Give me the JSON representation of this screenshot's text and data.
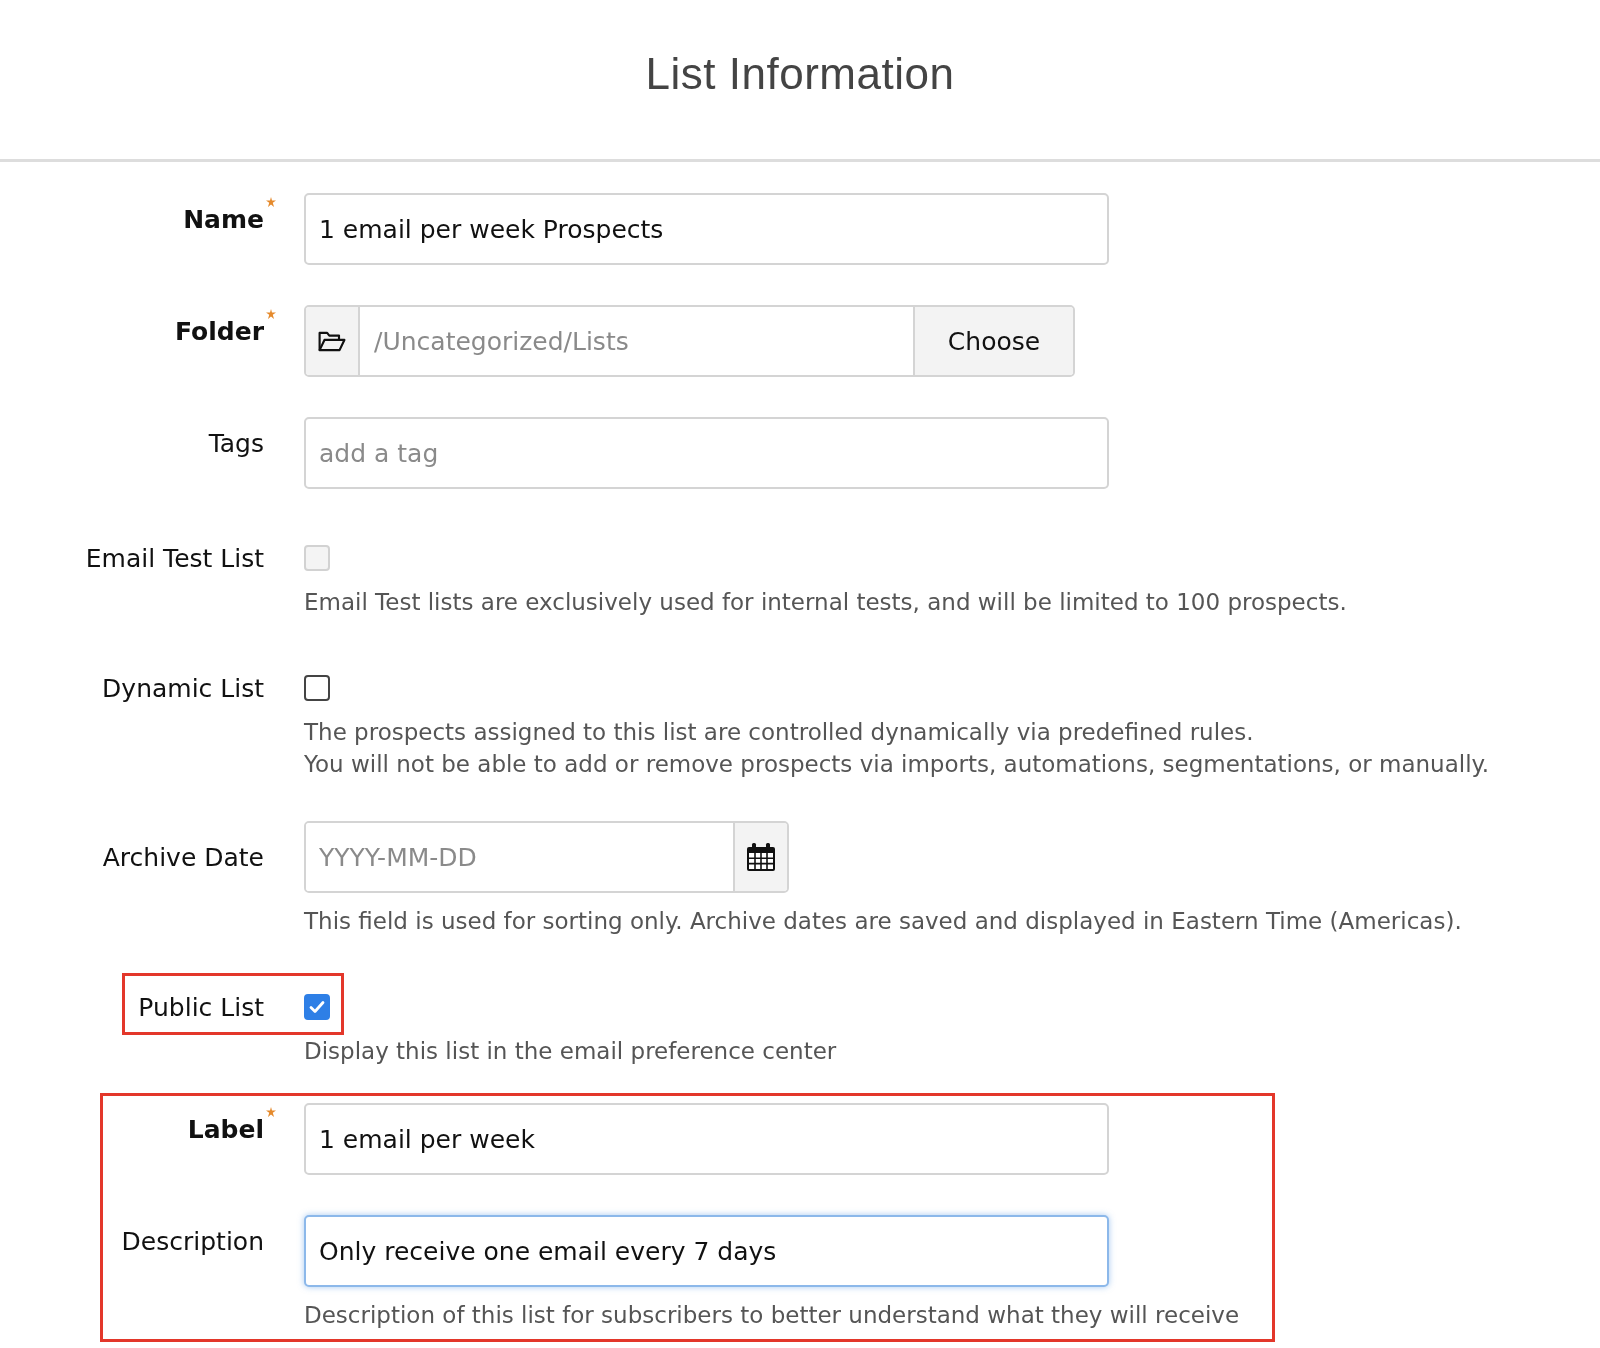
{
  "title": "List Information",
  "fields": [
    {
      "kind": "text",
      "label": "Name",
      "required": true,
      "value": "1 email per week Prospects"
    },
    {
      "kind": "folder",
      "label": "Folder",
      "required": true,
      "placeholder": "/Uncategorized/Lists",
      "button": "Choose"
    },
    {
      "kind": "text",
      "label": "Tags",
      "required": false,
      "placeholder": "add a tag"
    },
    {
      "kind": "checkbox",
      "label": "Email Test List",
      "required": false,
      "checked": false,
      "disabled": true,
      "highlighted": false,
      "help": [
        "Email Test lists are exclusively used for internal tests, and will be limited to 100 prospects."
      ]
    },
    {
      "kind": "checkbox",
      "label": "Dynamic List",
      "required": false,
      "checked": false,
      "disabled": false,
      "highlighted": false,
      "help": [
        "The prospects assigned to this list are controlled dynamically via predefined rules.",
        "You will not be able to add or remove prospects via imports, automations, segmentations, or manually."
      ]
    },
    {
      "kind": "date",
      "label": "Archive Date",
      "required": false,
      "placeholder": "YYYY-MM-DD",
      "help": [
        "This field is used for sorting only. Archive dates are saved and displayed in Eastern Time (Americas)."
      ]
    },
    {
      "kind": "checkbox",
      "label": "Public List",
      "required": false,
      "checked": true,
      "disabled": false,
      "highlighted": true,
      "help": [
        "Display this list in the email preference center"
      ]
    }
  ],
  "preference_group": {
    "highlighted": true,
    "fields": [
      {
        "kind": "text",
        "label": "Label",
        "required": true,
        "value": "1 email per week",
        "focused": false
      },
      {
        "kind": "text",
        "label": "Description",
        "required": false,
        "value": "Only receive one email every 7 days",
        "focused": true,
        "help": [
          "Description of this list for subscribers to better understand what they will receive"
        ]
      }
    ]
  }
}
